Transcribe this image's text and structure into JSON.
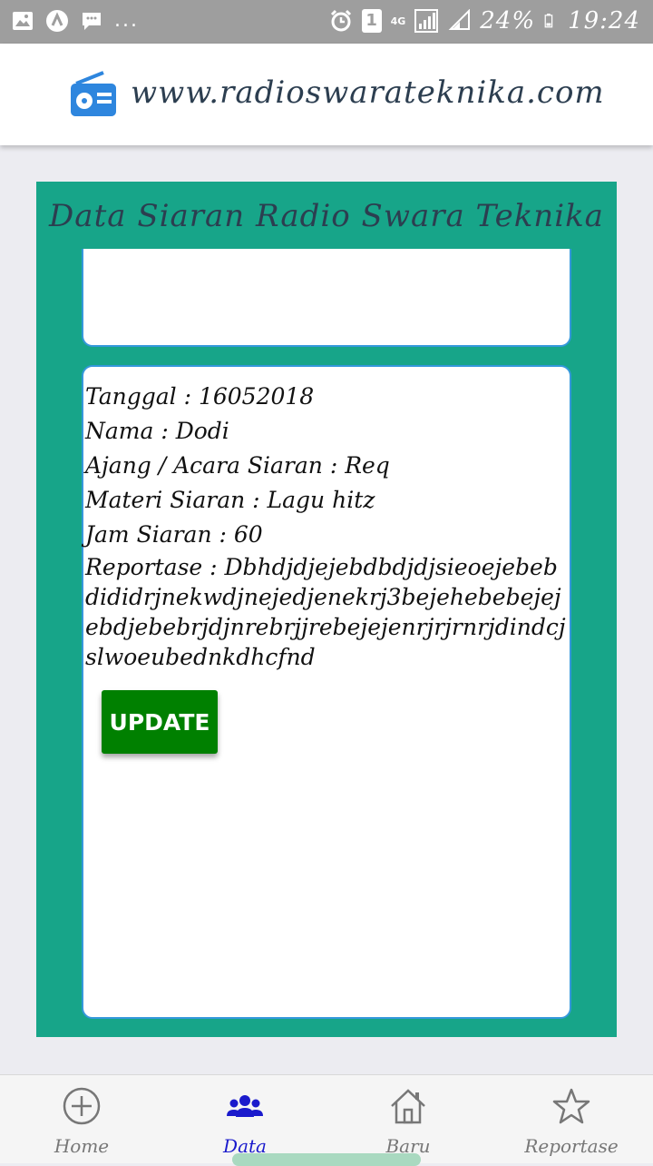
{
  "status_bar": {
    "dots": "...",
    "sim_badge": "1",
    "network": "4G",
    "battery": "24%",
    "time": "19:24"
  },
  "header": {
    "site": "www.radioswarateknika.com",
    "icon": "radio-icon"
  },
  "panel": {
    "title": "Data Siaran Radio Swara Teknika",
    "record": {
      "tanggal": "Tanggal : 16052018",
      "nama": "Nama : Dodi",
      "ajang": "Ajang / Acara Siaran : Req",
      "materi": "Materi Siaran : Lagu hitz",
      "jam": "Jam Siaran : 60",
      "reportase": "Reportase : Dbhdjdjejebdbdjdjsieoejebebdididrjnekwdjnejedjenekrj3bejehebebejejebdjebebrjdjnrebrjjrebejejenrjrjrnrjdindcjslwoeubednkdhcfnd"
    },
    "update_label": "UPDATE"
  },
  "bottom_nav": {
    "items": [
      {
        "label": "Home",
        "icon": "plus-circle-icon"
      },
      {
        "label": "Data",
        "icon": "users-icon"
      },
      {
        "label": "Baru",
        "icon": "home-icon"
      },
      {
        "label": "Reportase",
        "icon": "star-icon"
      }
    ],
    "active": "Data"
  },
  "colors": {
    "panel": "#17a589",
    "title_text": "#2c3e50",
    "update_button": "#008000",
    "active_nav": "#1a1acc"
  }
}
